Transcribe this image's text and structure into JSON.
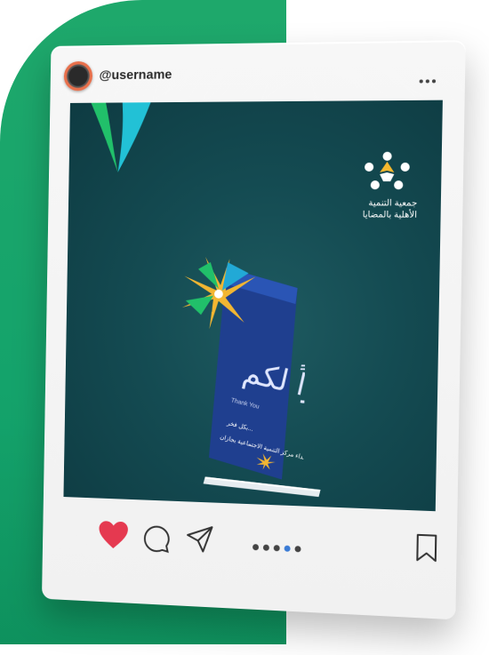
{
  "post": {
    "username": "@username",
    "icons": {
      "avatar": "avatar",
      "more": "more-icon",
      "like": "heart-icon",
      "comment": "comment-icon",
      "share": "send-icon",
      "bookmark": "bookmark-icon"
    },
    "carousel": {
      "count": 5,
      "active_index": 3
    },
    "colors": {
      "background_band": "#1ea86b",
      "image_background": "#144b52",
      "like_red": "#e53950",
      "active_dot": "#3a7bd5"
    }
  },
  "image": {
    "org_name_line1": "جمعية التنمية",
    "org_name_line2": "الأهلية بالمضايا",
    "trophy_title": "شكراً لكم",
    "trophy_subtitle": "Thank You",
    "trophy_text_line1": "بكل فخر...",
    "trophy_text_line2": "إهداء مركز التنمية الاجتماعية بجازان"
  }
}
